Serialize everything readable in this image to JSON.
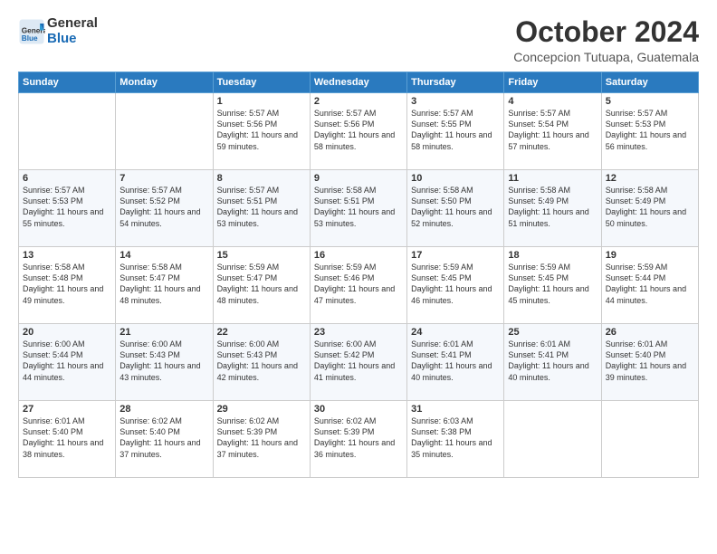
{
  "logo": {
    "general": "General",
    "blue": "Blue"
  },
  "header": {
    "month": "October 2024",
    "location": "Concepcion Tutuapa, Guatemala"
  },
  "weekdays": [
    "Sunday",
    "Monday",
    "Tuesday",
    "Wednesday",
    "Thursday",
    "Friday",
    "Saturday"
  ],
  "weeks": [
    [
      {
        "day": "",
        "info": ""
      },
      {
        "day": "",
        "info": ""
      },
      {
        "day": "1",
        "info": "Sunrise: 5:57 AM\nSunset: 5:56 PM\nDaylight: 11 hours and 59 minutes."
      },
      {
        "day": "2",
        "info": "Sunrise: 5:57 AM\nSunset: 5:56 PM\nDaylight: 11 hours and 58 minutes."
      },
      {
        "day": "3",
        "info": "Sunrise: 5:57 AM\nSunset: 5:55 PM\nDaylight: 11 hours and 58 minutes."
      },
      {
        "day": "4",
        "info": "Sunrise: 5:57 AM\nSunset: 5:54 PM\nDaylight: 11 hours and 57 minutes."
      },
      {
        "day": "5",
        "info": "Sunrise: 5:57 AM\nSunset: 5:53 PM\nDaylight: 11 hours and 56 minutes."
      }
    ],
    [
      {
        "day": "6",
        "info": "Sunrise: 5:57 AM\nSunset: 5:53 PM\nDaylight: 11 hours and 55 minutes."
      },
      {
        "day": "7",
        "info": "Sunrise: 5:57 AM\nSunset: 5:52 PM\nDaylight: 11 hours and 54 minutes."
      },
      {
        "day": "8",
        "info": "Sunrise: 5:57 AM\nSunset: 5:51 PM\nDaylight: 11 hours and 53 minutes."
      },
      {
        "day": "9",
        "info": "Sunrise: 5:58 AM\nSunset: 5:51 PM\nDaylight: 11 hours and 53 minutes."
      },
      {
        "day": "10",
        "info": "Sunrise: 5:58 AM\nSunset: 5:50 PM\nDaylight: 11 hours and 52 minutes."
      },
      {
        "day": "11",
        "info": "Sunrise: 5:58 AM\nSunset: 5:49 PM\nDaylight: 11 hours and 51 minutes."
      },
      {
        "day": "12",
        "info": "Sunrise: 5:58 AM\nSunset: 5:49 PM\nDaylight: 11 hours and 50 minutes."
      }
    ],
    [
      {
        "day": "13",
        "info": "Sunrise: 5:58 AM\nSunset: 5:48 PM\nDaylight: 11 hours and 49 minutes."
      },
      {
        "day": "14",
        "info": "Sunrise: 5:58 AM\nSunset: 5:47 PM\nDaylight: 11 hours and 48 minutes."
      },
      {
        "day": "15",
        "info": "Sunrise: 5:59 AM\nSunset: 5:47 PM\nDaylight: 11 hours and 48 minutes."
      },
      {
        "day": "16",
        "info": "Sunrise: 5:59 AM\nSunset: 5:46 PM\nDaylight: 11 hours and 47 minutes."
      },
      {
        "day": "17",
        "info": "Sunrise: 5:59 AM\nSunset: 5:45 PM\nDaylight: 11 hours and 46 minutes."
      },
      {
        "day": "18",
        "info": "Sunrise: 5:59 AM\nSunset: 5:45 PM\nDaylight: 11 hours and 45 minutes."
      },
      {
        "day": "19",
        "info": "Sunrise: 5:59 AM\nSunset: 5:44 PM\nDaylight: 11 hours and 44 minutes."
      }
    ],
    [
      {
        "day": "20",
        "info": "Sunrise: 6:00 AM\nSunset: 5:44 PM\nDaylight: 11 hours and 44 minutes."
      },
      {
        "day": "21",
        "info": "Sunrise: 6:00 AM\nSunset: 5:43 PM\nDaylight: 11 hours and 43 minutes."
      },
      {
        "day": "22",
        "info": "Sunrise: 6:00 AM\nSunset: 5:43 PM\nDaylight: 11 hours and 42 minutes."
      },
      {
        "day": "23",
        "info": "Sunrise: 6:00 AM\nSunset: 5:42 PM\nDaylight: 11 hours and 41 minutes."
      },
      {
        "day": "24",
        "info": "Sunrise: 6:01 AM\nSunset: 5:41 PM\nDaylight: 11 hours and 40 minutes."
      },
      {
        "day": "25",
        "info": "Sunrise: 6:01 AM\nSunset: 5:41 PM\nDaylight: 11 hours and 40 minutes."
      },
      {
        "day": "26",
        "info": "Sunrise: 6:01 AM\nSunset: 5:40 PM\nDaylight: 11 hours and 39 minutes."
      }
    ],
    [
      {
        "day": "27",
        "info": "Sunrise: 6:01 AM\nSunset: 5:40 PM\nDaylight: 11 hours and 38 minutes."
      },
      {
        "day": "28",
        "info": "Sunrise: 6:02 AM\nSunset: 5:40 PM\nDaylight: 11 hours and 37 minutes."
      },
      {
        "day": "29",
        "info": "Sunrise: 6:02 AM\nSunset: 5:39 PM\nDaylight: 11 hours and 37 minutes."
      },
      {
        "day": "30",
        "info": "Sunrise: 6:02 AM\nSunset: 5:39 PM\nDaylight: 11 hours and 36 minutes."
      },
      {
        "day": "31",
        "info": "Sunrise: 6:03 AM\nSunset: 5:38 PM\nDaylight: 11 hours and 35 minutes."
      },
      {
        "day": "",
        "info": ""
      },
      {
        "day": "",
        "info": ""
      }
    ]
  ]
}
